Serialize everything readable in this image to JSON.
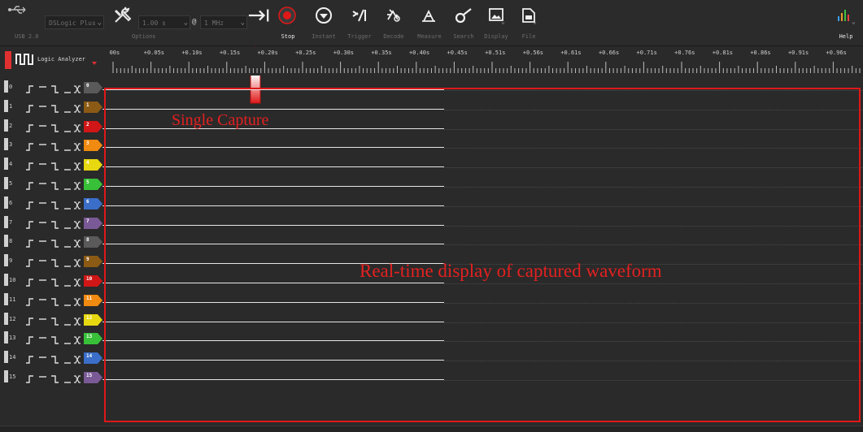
{
  "toolbar": {
    "usb_label": "USB 2.0",
    "device_select": "DSLogic Plus",
    "options_label": "Options",
    "duration_select": "1.00 s",
    "at_symbol": "@",
    "rate_select": "1 MHz",
    "buttons": [
      {
        "label": "Stop",
        "icon": "stop-icon",
        "active": true
      },
      {
        "label": "Instant",
        "icon": "instant-icon",
        "active": false
      },
      {
        "label": "Trigger",
        "icon": "trigger-icon",
        "active": false
      },
      {
        "label": "Decode",
        "icon": "decode-icon",
        "active": false
      },
      {
        "label": "Measure",
        "icon": "measure-icon",
        "active": false
      },
      {
        "label": "Search",
        "icon": "search-icon",
        "active": false
      },
      {
        "label": "Display",
        "icon": "display-icon",
        "active": false
      },
      {
        "label": "File",
        "icon": "file-icon",
        "active": false
      }
    ],
    "help_label": "Help"
  },
  "timeline": {
    "mode_label": "Logic Analyzer",
    "ticks": [
      "00s",
      "+0.05s",
      "+0.10s",
      "+0.15s",
      "+0.20s",
      "+0.25s",
      "+0.30s",
      "+0.35s",
      "+0.40s",
      "+0.45s",
      "+0.51s",
      "+0.56s",
      "+0.61s",
      "+0.66s",
      "+0.71s",
      "+0.76s",
      "+0.81s",
      "+0.86s",
      "+0.91s",
      "+0.96s"
    ]
  },
  "channels": [
    {
      "index": "0",
      "tag": "0",
      "color": "#5a5a5a"
    },
    {
      "index": "1",
      "tag": "1",
      "color": "#8b5a14"
    },
    {
      "index": "2",
      "tag": "2",
      "color": "#d01616"
    },
    {
      "index": "3",
      "tag": "3",
      "color": "#f08a10"
    },
    {
      "index": "4",
      "tag": "4",
      "color": "#e8d810"
    },
    {
      "index": "5",
      "tag": "5",
      "color": "#38c038"
    },
    {
      "index": "6",
      "tag": "6",
      "color": "#3a6ec8"
    },
    {
      "index": "7",
      "tag": "7",
      "color": "#7a5a96"
    },
    {
      "index": "8",
      "tag": "8",
      "color": "#5a5a5a"
    },
    {
      "index": "9",
      "tag": "9",
      "color": "#8b5a14"
    },
    {
      "index": "10",
      "tag": "10",
      "color": "#d01616"
    },
    {
      "index": "11",
      "tag": "11",
      "color": "#f08a10"
    },
    {
      "index": "12",
      "tag": "12",
      "color": "#e8d810"
    },
    {
      "index": "13",
      "tag": "13",
      "color": "#38c038"
    },
    {
      "index": "14",
      "tag": "14",
      "color": "#3a6ec8"
    },
    {
      "index": "15",
      "tag": "15",
      "color": "#7a5a96"
    }
  ],
  "annotations": {
    "single_capture": "Single Capture",
    "realtime": "Real-time display of captured waveform"
  },
  "colors": {
    "annotation": "#e01818",
    "background": "#2a2a2a"
  }
}
